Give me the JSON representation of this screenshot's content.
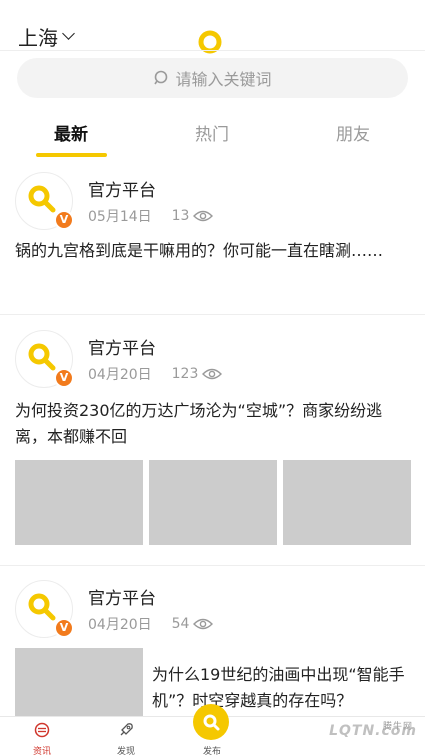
{
  "header": {
    "city": "上海",
    "search_placeholder": "请输入关键词"
  },
  "tabs": [
    {
      "label": "最新",
      "active": true
    },
    {
      "label": "热门",
      "active": false
    },
    {
      "label": "朋友",
      "active": false
    }
  ],
  "posts": [
    {
      "author": "官方平台",
      "date": "05月14日",
      "views": "13",
      "title": "锅的九宫格到底是干嘛用的？你可能一直在瞎涮……",
      "badge": "V"
    },
    {
      "author": "官方平台",
      "date": "04月20日",
      "views": "123",
      "title": "为何投资230亿的万达广场沦为“空城”？商家纷纷逃离，本都赚不回",
      "badge": "V"
    },
    {
      "author": "官方平台",
      "date": "04月20日",
      "views": "54",
      "title": "为什么19世纪的油画中出现“智能手机”？时空穿越真的存在吗？",
      "badge": "V"
    }
  ],
  "bottom_nav": [
    {
      "label": "资讯",
      "icon": "news-icon",
      "active": true
    },
    {
      "label": "发现",
      "icon": "rocket-icon",
      "active": false
    },
    {
      "label": "发布",
      "icon": "publish-icon",
      "active": false
    }
  ],
  "watermark": {
    "text": "LQTN.com",
    "small": "腾牛网"
  },
  "colors": {
    "accent": "#f5c800",
    "badge": "#f27b1d",
    "nav_active": "#d0362c",
    "thumb": "#cccccc"
  }
}
